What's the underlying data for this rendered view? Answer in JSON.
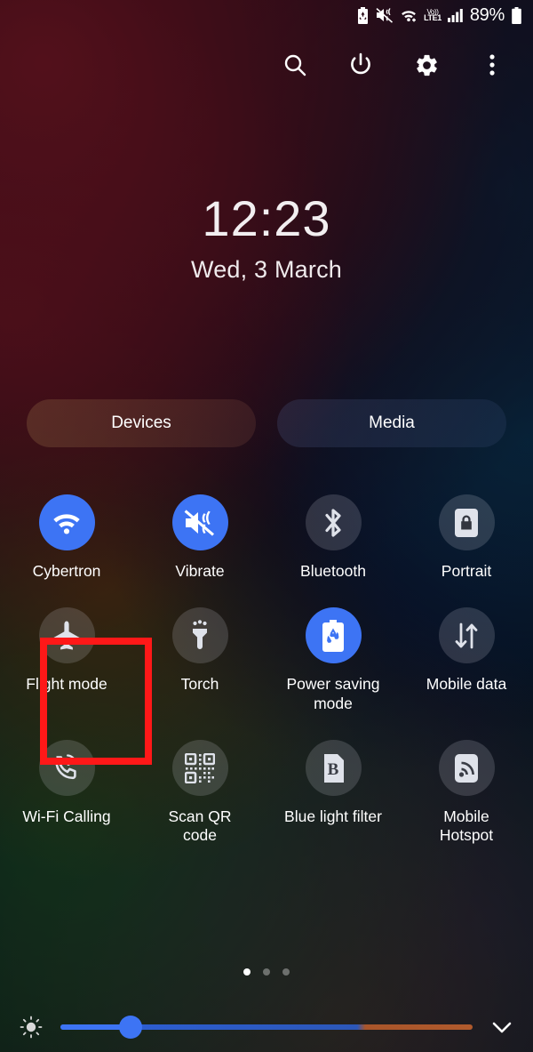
{
  "status_bar": {
    "icons": [
      "power-saving-icon",
      "vibrate-icon",
      "wifi-icon",
      "volte-icon",
      "signal-icon"
    ],
    "volte_top": "Vo))",
    "volte_bottom": "LTE1",
    "battery_percent": "89%"
  },
  "header": {
    "buttons": [
      {
        "name": "search-icon",
        "label": "Search"
      },
      {
        "name": "power-icon",
        "label": "Power"
      },
      {
        "name": "settings-gear-icon",
        "label": "Settings"
      },
      {
        "name": "overflow-menu-icon",
        "label": "More options"
      }
    ]
  },
  "clock": {
    "time": "12:23",
    "date": "Wed, 3 March"
  },
  "pills": {
    "devices": "Devices",
    "media": "Media"
  },
  "tiles": [
    {
      "label": "Cybertron",
      "icon": "wifi-icon",
      "active": true
    },
    {
      "label": "Vibrate",
      "icon": "vibrate-icon",
      "active": true
    },
    {
      "label": "Bluetooth",
      "icon": "bluetooth-icon",
      "active": false
    },
    {
      "label": "Portrait",
      "icon": "rotation-lock-icon",
      "active": false
    },
    {
      "label": "Flight mode",
      "icon": "airplane-icon",
      "active": false
    },
    {
      "label": "Torch",
      "icon": "flashlight-icon",
      "active": false
    },
    {
      "label": "Power saving mode",
      "icon": "power-saving-icon",
      "active": true
    },
    {
      "label": "Mobile data",
      "icon": "data-arrows-icon",
      "active": false
    },
    {
      "label": "Wi-Fi Calling",
      "icon": "wifi-calling-icon",
      "active": false
    },
    {
      "label": "Scan QR code",
      "icon": "qr-code-icon",
      "active": false
    },
    {
      "label": "Blue light filter",
      "icon": "blue-light-icon",
      "active": false
    },
    {
      "label": "Mobile Hotspot",
      "icon": "hotspot-icon",
      "active": false
    }
  ],
  "highlight": {
    "target": "Flight mode",
    "color": "#fe1818"
  },
  "page_dots": {
    "count": 3,
    "active_index": 0
  },
  "brightness": {
    "value_percent": 17,
    "auto_icon": "brightness-icon",
    "expand_icon": "chevron-down-icon"
  },
  "colors": {
    "accent": "#3d74f4",
    "highlight": "#fe1818",
    "tile_off": "rgba(225,228,240,0.17)"
  }
}
